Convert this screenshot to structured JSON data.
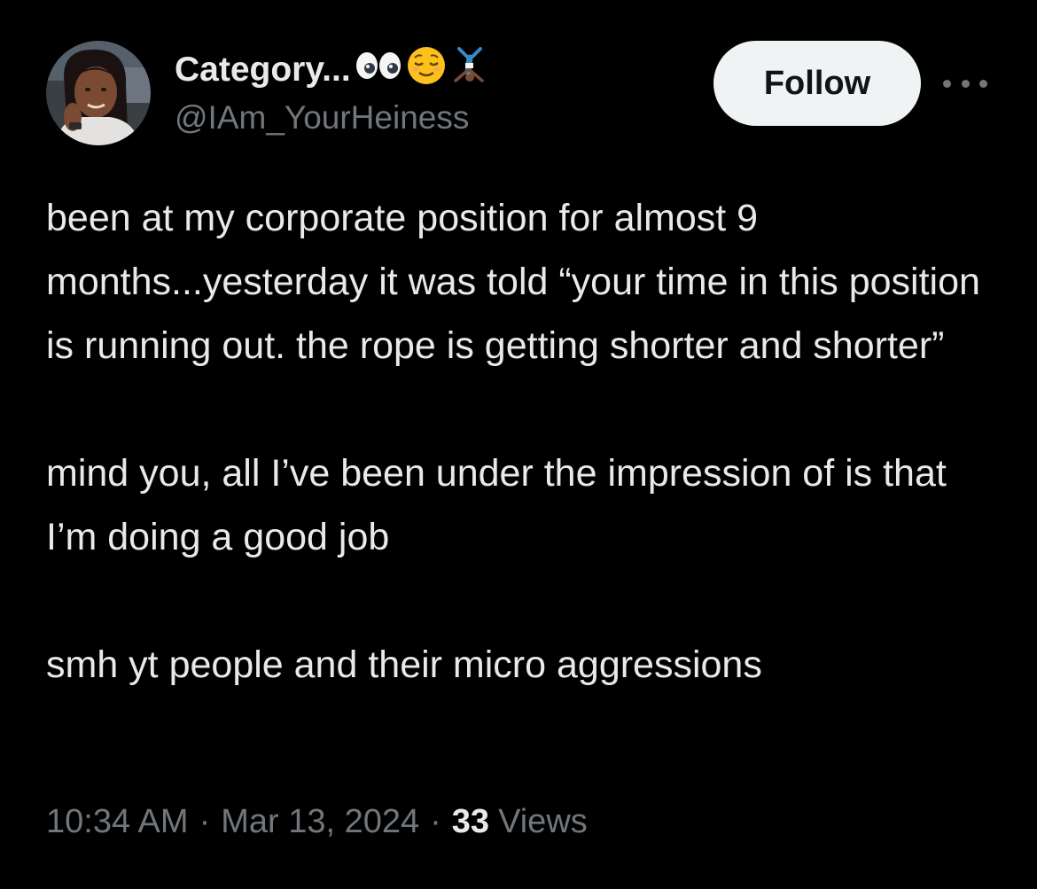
{
  "author": {
    "display_name": "Category...",
    "handle": "@IAm_YourHeiness",
    "name_emojis": [
      "eyes-emoji",
      "relieved-face-emoji",
      "cartwheel-person-emoji"
    ]
  },
  "actions": {
    "follow_label": "Follow",
    "more_icon": "ellipsis-icon"
  },
  "tweet": {
    "paragraph_1": "been at my corporate position for almost 9 months...yesterday it was told “your time in this position is running out. the rope is getting shorter and shorter”",
    "paragraph_2": "mind you, all I’ve been under the impression of is that I’m doing a good job",
    "paragraph_3": "smh yt people and their micro aggressions"
  },
  "meta": {
    "time": "10:34 AM",
    "separator": "·",
    "date": "Mar 13, 2024",
    "views_count": "33",
    "views_label": "Views"
  },
  "colors": {
    "background": "#000000",
    "primary_text": "#e7e9ea",
    "secondary_text": "#71767b",
    "follow_button_bg": "#eff3f4",
    "follow_button_text": "#0f1419"
  }
}
